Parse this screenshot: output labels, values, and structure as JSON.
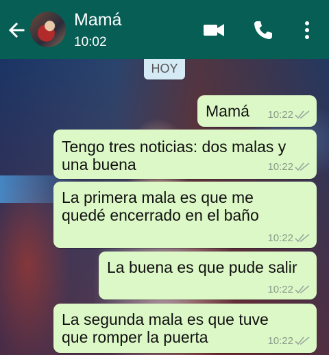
{
  "header": {
    "contact_name": "Mamá",
    "status": "10:02",
    "icons": [
      "back-arrow-icon",
      "video-call-icon",
      "phone-icon",
      "more-vert-icon"
    ],
    "background": "#075e54"
  },
  "chat": {
    "date_label": "HOY",
    "bubble_color": "#dcf8c6",
    "messages": [
      {
        "text": "Mamá",
        "time": "10:22"
      },
      {
        "line1": "Tengo tres noticias: dos malas y",
        "line2": "una buena",
        "time": "10:22"
      },
      {
        "line1": "La primera mala es que me",
        "line2": "quedé encerrado en el baño",
        "time": "10:22"
      },
      {
        "text": "La buena es que pude salir",
        "time": "10:22"
      },
      {
        "line1": "La segunda mala es que tuve",
        "line2": "que romper la puerta",
        "time": "10:22"
      }
    ]
  }
}
